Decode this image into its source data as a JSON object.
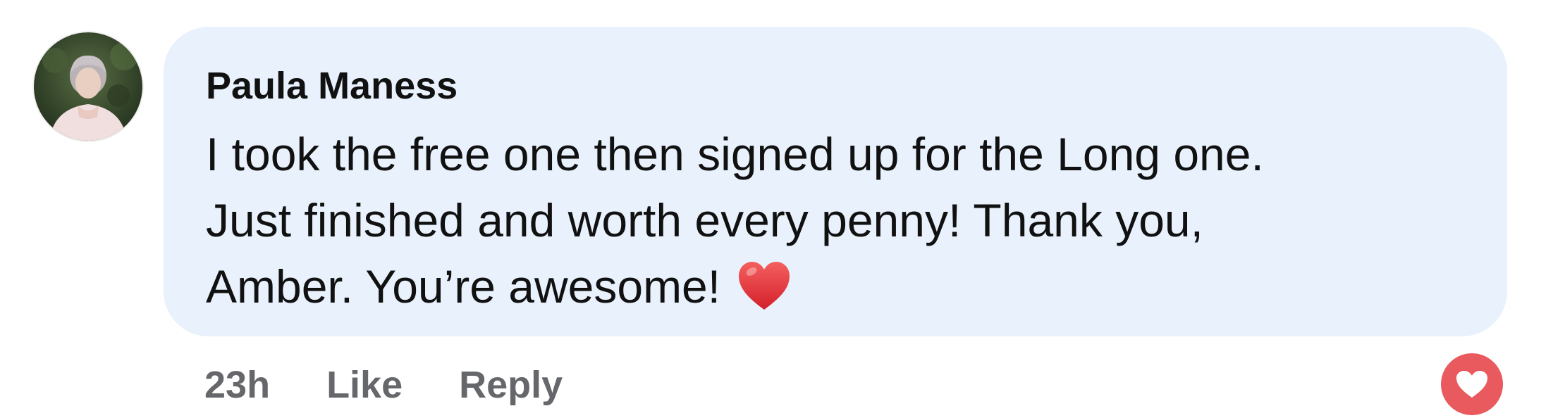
{
  "comment": {
    "author": "Paula Maness",
    "text_lines": [
      "I took the free one then signed up for the Long one.",
      "Just finished and worth every penny! Thank you,",
      "Amber. You’re awesome!"
    ],
    "emoji": "red-heart-icon",
    "time": "23h",
    "like_label": "Like",
    "reply_label": "Reply",
    "reaction": "love-reaction-icon"
  },
  "colors": {
    "bubble": "#e8f1fc",
    "meta_text": "#65676b",
    "reaction": "#e95a5f",
    "emoji_heart": "#e33a3f"
  }
}
